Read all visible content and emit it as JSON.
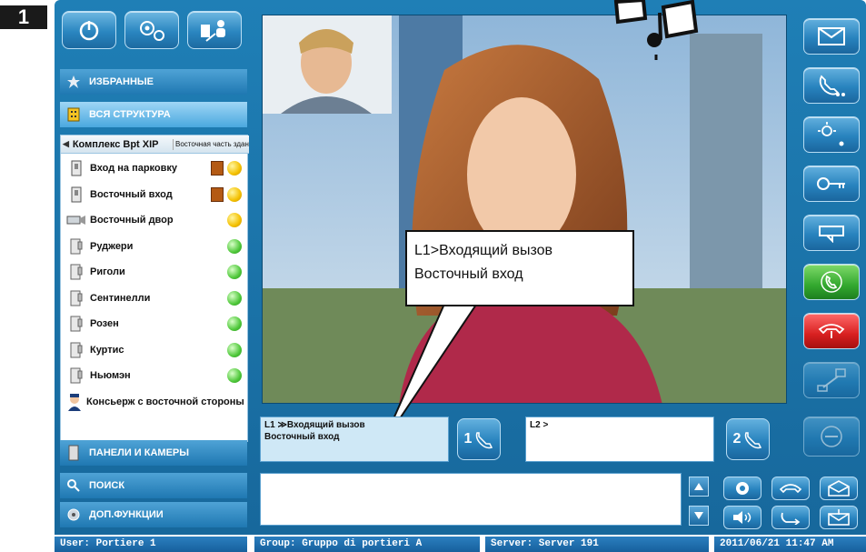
{
  "badge": "1",
  "sidebar": {
    "favorites_label": "ИЗБРАННЫЕ",
    "structure_label": "ВСЯ СТРУКТУРА",
    "breadcrumb_main": "Комплекс Bpt XIP",
    "breadcrumb_sub": "Восточная часть здания",
    "items": [
      {
        "label": "Вход на парковку",
        "status": "yellow",
        "door": true,
        "icon": "door-panel-icon"
      },
      {
        "label": "Восточный вход",
        "status": "yellow",
        "door": true,
        "icon": "door-panel-icon"
      },
      {
        "label": "Восточный двор",
        "status": "yellow",
        "door": false,
        "icon": "camera-icon"
      },
      {
        "label": "Руджери",
        "status": "green",
        "door": false,
        "icon": "apartment-icon"
      },
      {
        "label": "Риголи",
        "status": "green",
        "door": false,
        "icon": "apartment-icon"
      },
      {
        "label": "Сентинелли",
        "status": "green",
        "door": false,
        "icon": "apartment-icon"
      },
      {
        "label": "Розен",
        "status": "green",
        "door": false,
        "icon": "apartment-icon"
      },
      {
        "label": "Куртис",
        "status": "green",
        "door": false,
        "icon": "apartment-icon"
      },
      {
        "label": "Ньюмэн",
        "status": "green",
        "door": false,
        "icon": "apartment-icon"
      },
      {
        "label": "Консьерж с восточной стороны",
        "status": "yellow",
        "door": false,
        "icon": "concierge-icon"
      }
    ],
    "panels_label": "ПАНЕЛИ И КАМЕРЫ",
    "search_label": "ПОИСК",
    "extra_label": "ДОП.ФУНКЦИИ"
  },
  "calls": {
    "line1_text": "L1 ≫Входящий вызов\nВосточный вход",
    "line1_button": "1",
    "line2_text": "L2 >",
    "line2_button": "2"
  },
  "bubble": {
    "line1": "L1>Входящий вызов",
    "line2": "Восточный вход"
  },
  "status_bar": {
    "user": "User: Portiere 1",
    "group": "Group: Gruppo di portieri A",
    "server": "Server: Server 191",
    "datetime": "2011/06/21 11:47 AM"
  },
  "colors": {
    "frame": "#1f7fb6",
    "accent_green": "#33a82f",
    "accent_red": "#d82020",
    "status_yellow": "#f4c000",
    "status_green": "#4fc83a"
  }
}
